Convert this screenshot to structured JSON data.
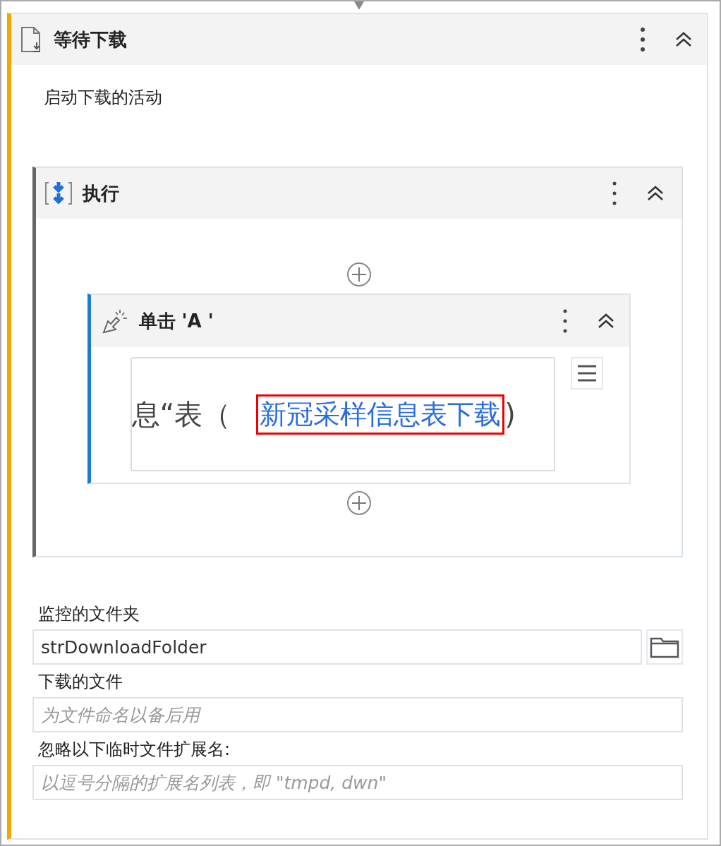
{
  "activity": {
    "title": "等待下载",
    "collapsed": false,
    "trigger_label": "启动下载的活动",
    "sequence": {
      "title": "执行",
      "collapsed": false,
      "click": {
        "title": "单击 'A '",
        "collapsed": false,
        "screenshot": {
          "text_before": "息“表（",
          "target_text": "新冠采样信息表下载",
          "text_after": ")"
        }
      }
    },
    "fields": [
      {
        "label": "监控的文件夹",
        "value": "strDownloadFolder",
        "kind": "folder"
      },
      {
        "label": "下载的文件",
        "placeholder": "为文件命名以备后用",
        "kind": "text"
      },
      {
        "label": "忽略以下临时文件扩展名:",
        "placeholder": "以逗号分隔的扩展名列表，即 \"tmpd, dwn\"",
        "kind": "text"
      }
    ]
  }
}
